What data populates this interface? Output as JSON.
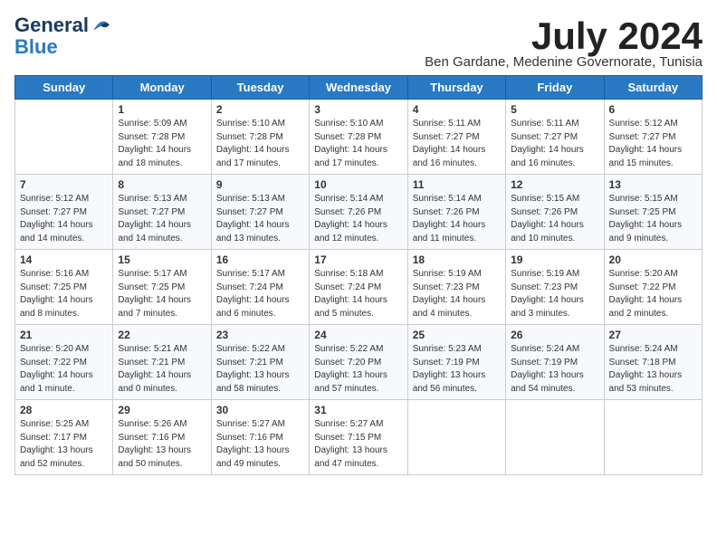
{
  "logo": {
    "line1": "General",
    "line2": "Blue"
  },
  "title": "July 2024",
  "location": "Ben Gardane, Medenine Governorate, Tunisia",
  "headers": [
    "Sunday",
    "Monday",
    "Tuesday",
    "Wednesday",
    "Thursday",
    "Friday",
    "Saturday"
  ],
  "weeks": [
    [
      {
        "day": "",
        "info": ""
      },
      {
        "day": "1",
        "info": "Sunrise: 5:09 AM\nSunset: 7:28 PM\nDaylight: 14 hours\nand 18 minutes."
      },
      {
        "day": "2",
        "info": "Sunrise: 5:10 AM\nSunset: 7:28 PM\nDaylight: 14 hours\nand 17 minutes."
      },
      {
        "day": "3",
        "info": "Sunrise: 5:10 AM\nSunset: 7:28 PM\nDaylight: 14 hours\nand 17 minutes."
      },
      {
        "day": "4",
        "info": "Sunrise: 5:11 AM\nSunset: 7:27 PM\nDaylight: 14 hours\nand 16 minutes."
      },
      {
        "day": "5",
        "info": "Sunrise: 5:11 AM\nSunset: 7:27 PM\nDaylight: 14 hours\nand 16 minutes."
      },
      {
        "day": "6",
        "info": "Sunrise: 5:12 AM\nSunset: 7:27 PM\nDaylight: 14 hours\nand 15 minutes."
      }
    ],
    [
      {
        "day": "7",
        "info": "Sunrise: 5:12 AM\nSunset: 7:27 PM\nDaylight: 14 hours\nand 14 minutes."
      },
      {
        "day": "8",
        "info": "Sunrise: 5:13 AM\nSunset: 7:27 PM\nDaylight: 14 hours\nand 14 minutes."
      },
      {
        "day": "9",
        "info": "Sunrise: 5:13 AM\nSunset: 7:27 PM\nDaylight: 14 hours\nand 13 minutes."
      },
      {
        "day": "10",
        "info": "Sunrise: 5:14 AM\nSunset: 7:26 PM\nDaylight: 14 hours\nand 12 minutes."
      },
      {
        "day": "11",
        "info": "Sunrise: 5:14 AM\nSunset: 7:26 PM\nDaylight: 14 hours\nand 11 minutes."
      },
      {
        "day": "12",
        "info": "Sunrise: 5:15 AM\nSunset: 7:26 PM\nDaylight: 14 hours\nand 10 minutes."
      },
      {
        "day": "13",
        "info": "Sunrise: 5:15 AM\nSunset: 7:25 PM\nDaylight: 14 hours\nand 9 minutes."
      }
    ],
    [
      {
        "day": "14",
        "info": "Sunrise: 5:16 AM\nSunset: 7:25 PM\nDaylight: 14 hours\nand 8 minutes."
      },
      {
        "day": "15",
        "info": "Sunrise: 5:17 AM\nSunset: 7:25 PM\nDaylight: 14 hours\nand 7 minutes."
      },
      {
        "day": "16",
        "info": "Sunrise: 5:17 AM\nSunset: 7:24 PM\nDaylight: 14 hours\nand 6 minutes."
      },
      {
        "day": "17",
        "info": "Sunrise: 5:18 AM\nSunset: 7:24 PM\nDaylight: 14 hours\nand 5 minutes."
      },
      {
        "day": "18",
        "info": "Sunrise: 5:19 AM\nSunset: 7:23 PM\nDaylight: 14 hours\nand 4 minutes."
      },
      {
        "day": "19",
        "info": "Sunrise: 5:19 AM\nSunset: 7:23 PM\nDaylight: 14 hours\nand 3 minutes."
      },
      {
        "day": "20",
        "info": "Sunrise: 5:20 AM\nSunset: 7:22 PM\nDaylight: 14 hours\nand 2 minutes."
      }
    ],
    [
      {
        "day": "21",
        "info": "Sunrise: 5:20 AM\nSunset: 7:22 PM\nDaylight: 14 hours\nand 1 minute."
      },
      {
        "day": "22",
        "info": "Sunrise: 5:21 AM\nSunset: 7:21 PM\nDaylight: 14 hours\nand 0 minutes."
      },
      {
        "day": "23",
        "info": "Sunrise: 5:22 AM\nSunset: 7:21 PM\nDaylight: 13 hours\nand 58 minutes."
      },
      {
        "day": "24",
        "info": "Sunrise: 5:22 AM\nSunset: 7:20 PM\nDaylight: 13 hours\nand 57 minutes."
      },
      {
        "day": "25",
        "info": "Sunrise: 5:23 AM\nSunset: 7:19 PM\nDaylight: 13 hours\nand 56 minutes."
      },
      {
        "day": "26",
        "info": "Sunrise: 5:24 AM\nSunset: 7:19 PM\nDaylight: 13 hours\nand 54 minutes."
      },
      {
        "day": "27",
        "info": "Sunrise: 5:24 AM\nSunset: 7:18 PM\nDaylight: 13 hours\nand 53 minutes."
      }
    ],
    [
      {
        "day": "28",
        "info": "Sunrise: 5:25 AM\nSunset: 7:17 PM\nDaylight: 13 hours\nand 52 minutes."
      },
      {
        "day": "29",
        "info": "Sunrise: 5:26 AM\nSunset: 7:16 PM\nDaylight: 13 hours\nand 50 minutes."
      },
      {
        "day": "30",
        "info": "Sunrise: 5:27 AM\nSunset: 7:16 PM\nDaylight: 13 hours\nand 49 minutes."
      },
      {
        "day": "31",
        "info": "Sunrise: 5:27 AM\nSunset: 7:15 PM\nDaylight: 13 hours\nand 47 minutes."
      },
      {
        "day": "",
        "info": ""
      },
      {
        "day": "",
        "info": ""
      },
      {
        "day": "",
        "info": ""
      }
    ]
  ]
}
